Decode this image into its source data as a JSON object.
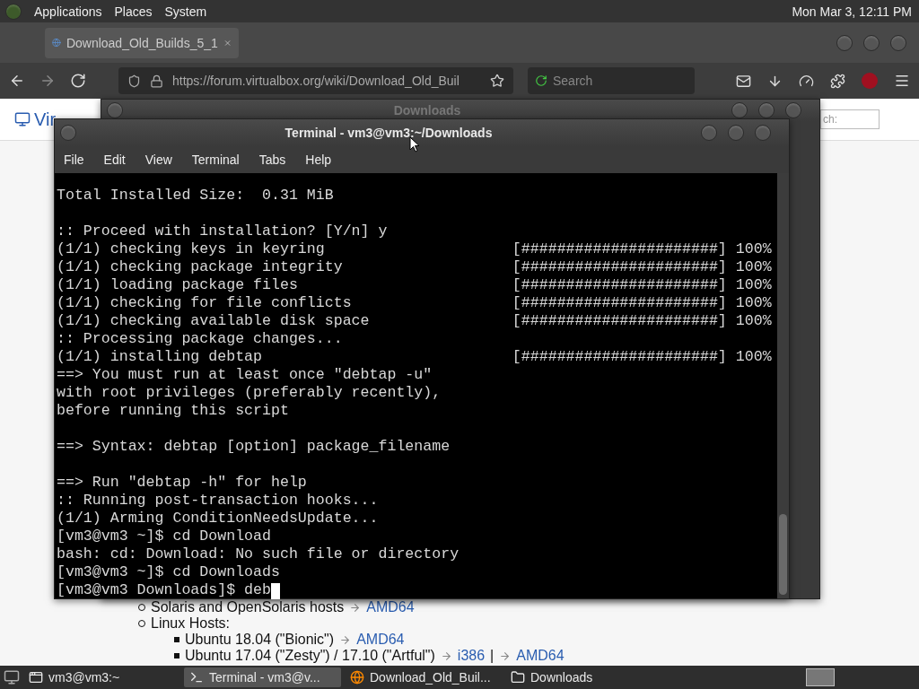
{
  "top_panel": {
    "menus": [
      "Applications",
      "Places",
      "System"
    ],
    "clock": "Mon Mar  3, 12:11 PM"
  },
  "browser": {
    "tab": {
      "title": "Download_Old_Builds_5_1",
      "selected": true
    },
    "url": "https://forum.virtualbox.org/wiki/Download_Old_Buil",
    "search": {
      "placeholder": "Search"
    },
    "page": {
      "logo_text": "Vir",
      "search_field": {
        "placeholder": "ch:"
      },
      "items": [
        {
          "text": "Solaris and OpenSolaris hosts",
          "links": [
            "AMD64"
          ]
        },
        {
          "text": "Linux Hosts:",
          "children": [
            {
              "text": "Ubuntu 18.04 (\"Bionic\")",
              "links": [
                "AMD64"
              ]
            },
            {
              "text": "Ubuntu 17.04 (\"Zesty\") / 17.10 (\"Artful\")",
              "links": [
                "i386",
                "AMD64"
              ],
              "link_separator": "|"
            }
          ]
        }
      ]
    }
  },
  "downloads_window": {
    "title": "Downloads"
  },
  "terminal": {
    "title": "Terminal - vm3@vm3:~/Downloads",
    "menu": [
      "File",
      "Edit",
      "View",
      "Terminal",
      "Tabs",
      "Help"
    ],
    "blocks": [
      {
        "lines": [
          {
            "kind": "text",
            "text": "Total Installed Size:  0.31 MiB"
          }
        ]
      },
      {
        "lines": [
          {
            "kind": "text",
            "text": ":: Proceed with installation? [Y/n] y"
          },
          {
            "kind": "progress",
            "text": "(1/1) checking keys in keyring",
            "bar": "[######################]",
            "percent": "100%"
          },
          {
            "kind": "progress",
            "text": "(1/1) checking package integrity",
            "bar": "[######################]",
            "percent": "100%"
          },
          {
            "kind": "progress",
            "text": "(1/1) loading package files",
            "bar": "[######################]",
            "percent": "100%"
          },
          {
            "kind": "progress",
            "text": "(1/1) checking for file conflicts",
            "bar": "[######################]",
            "percent": "100%"
          },
          {
            "kind": "progress",
            "text": "(1/1) checking available disk space",
            "bar": "[######################]",
            "percent": "100%"
          },
          {
            "kind": "text",
            "text": ":: Processing package changes..."
          },
          {
            "kind": "progress",
            "text": "(1/1) installing debtap",
            "bar": "[######################]",
            "percent": "100%"
          },
          {
            "kind": "text",
            "text": "==> You must run at least once \"debtap -u\""
          },
          {
            "kind": "text",
            "text": "with root privileges (preferably recently),"
          },
          {
            "kind": "text",
            "text": "before running this script"
          }
        ]
      },
      {
        "lines": [
          {
            "kind": "text",
            "text": "==> Syntax: debtap [option] package_filename"
          }
        ]
      },
      {
        "lines": [
          {
            "kind": "text",
            "text": "==> Run \"debtap -h\" for help"
          },
          {
            "kind": "text",
            "text": ":: Running post-transaction hooks..."
          },
          {
            "kind": "text",
            "text": "(1/1) Arming ConditionNeedsUpdate..."
          },
          {
            "kind": "text",
            "text": "[vm3@vm3 ~]$ cd Download"
          },
          {
            "kind": "text",
            "text": "bash: cd: Download: No such file or directory"
          },
          {
            "kind": "text",
            "text": "[vm3@vm3 ~]$ cd Downloads"
          },
          {
            "kind": "text",
            "text": "[vm3@vm3 Downloads]$ deb",
            "cursor": true
          }
        ]
      }
    ]
  },
  "taskbar": {
    "tasks": [
      {
        "label": "vm3@vm3:~",
        "kind": "window",
        "selected": false
      },
      {
        "label": "Terminal - vm3@v...",
        "kind": "terminal",
        "selected": true
      },
      {
        "label": "Download_Old_Buil...",
        "kind": "browser",
        "selected": false
      },
      {
        "label": "Downloads",
        "kind": "folder",
        "selected": false
      }
    ]
  }
}
